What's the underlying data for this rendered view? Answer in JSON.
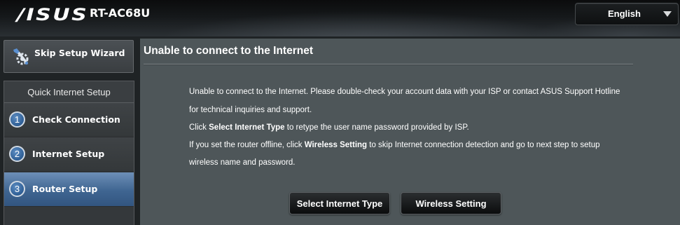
{
  "header": {
    "brand": "/ISUS",
    "model": "RT-AC68U",
    "language": {
      "selected": "English"
    }
  },
  "sidebar": {
    "skip_wizard_label": "Skip Setup Wizard",
    "steps_title": "Quick Internet Setup",
    "steps": [
      {
        "number": "1",
        "label": "Check Connection",
        "active": false
      },
      {
        "number": "2",
        "label": "Internet Setup",
        "active": false
      },
      {
        "number": "3",
        "label": "Router Setup",
        "active": true
      }
    ]
  },
  "main": {
    "title": "Unable to connect to the Internet",
    "lines": {
      "line1": "Unable to connect to the Internet. Please double-check your account data with your ISP or contact ASUS Support Hotline",
      "line2": "for technical inquiries and support.",
      "line3_pre": "Click ",
      "line3_bold": "Select Internet Type",
      "line3_post": " to retype the user name password provided by ISP.",
      "line4_pre": "If you set the router offline, click ",
      "line4_bold": "Wireless Setting",
      "line4_post": " to skip Internet connection detection and go to next step to setup",
      "line5": "wireless name and password."
    },
    "buttons": {
      "select_internet_type": "Select Internet Type",
      "wireless_setting": "Wireless Setting"
    }
  },
  "colors": {
    "header_bg": "#0b0c0d",
    "main_bg": "#4e5659",
    "sidebar_bg": "#34383b",
    "active_step": "#3f6591",
    "step_circle": "#2e5e95",
    "button_bg": "#0b0c0d",
    "text": "#ffffff"
  },
  "icons": {
    "skip_wizard": "wrench-gear-icon",
    "language_dropdown": "triangle-down-icon"
  }
}
